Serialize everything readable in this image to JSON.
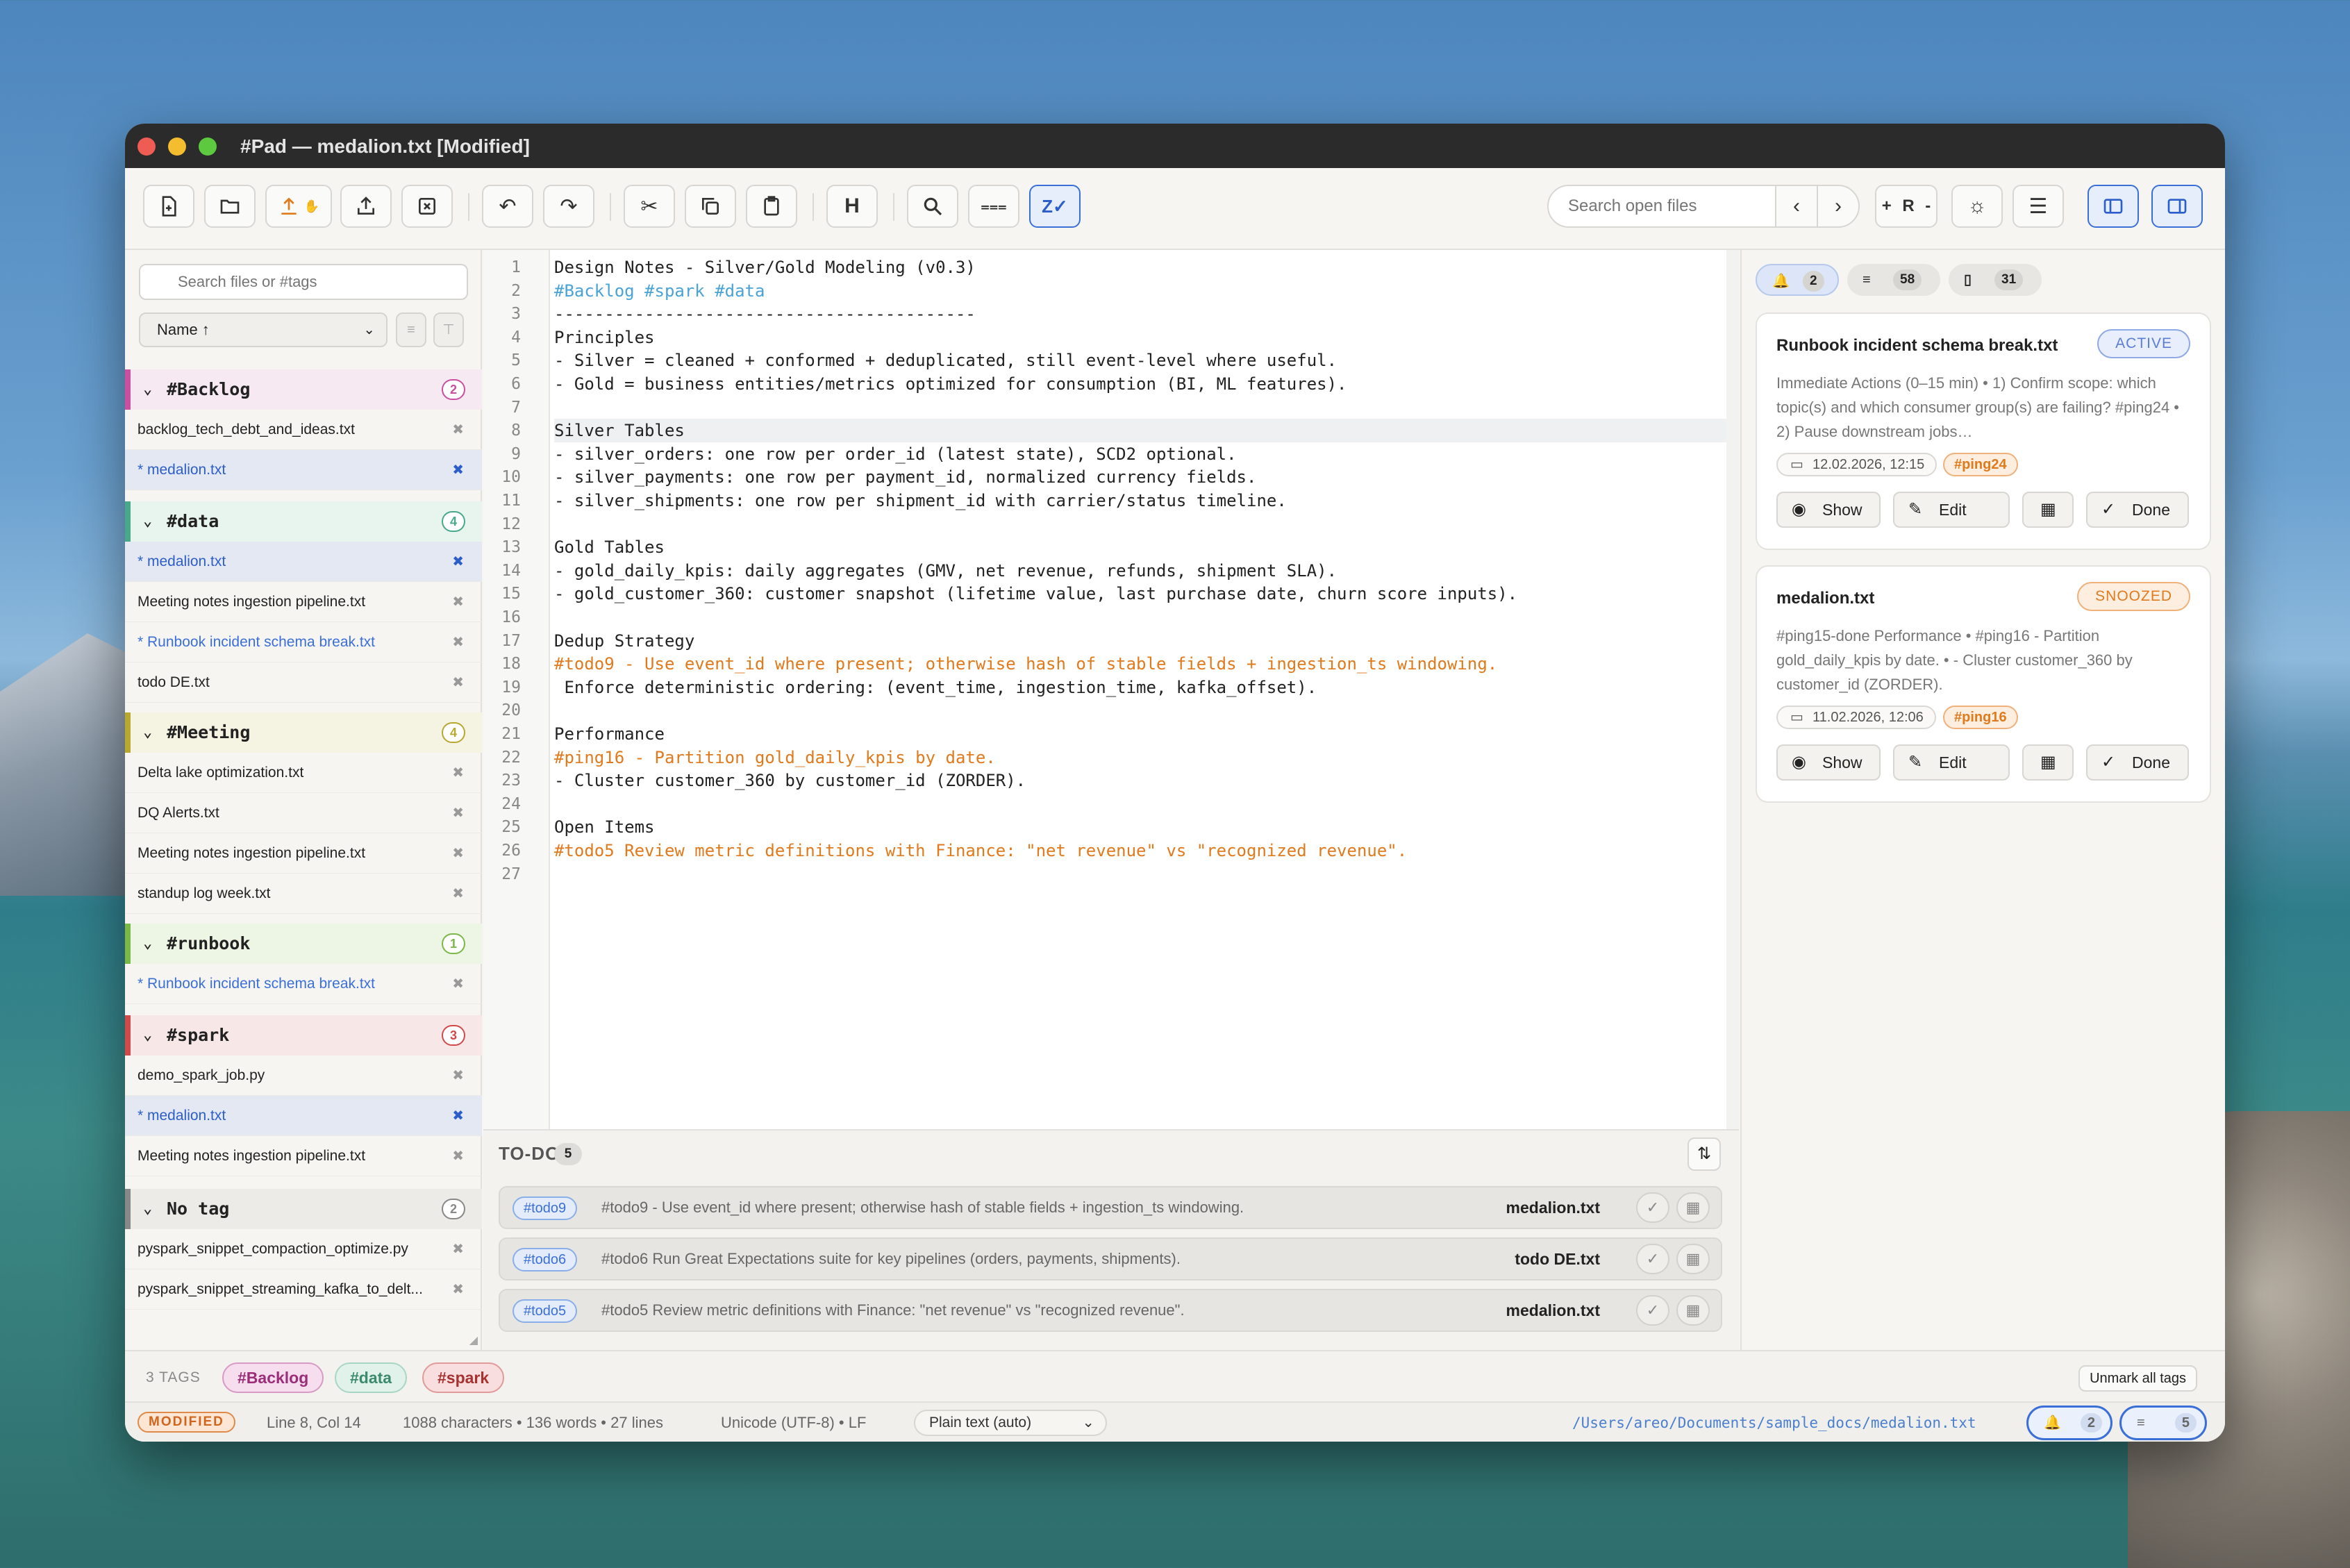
{
  "window": {
    "title": "#Pad — medalion.txt [Modified]"
  },
  "toolbar": {
    "search_placeholder": "Search open files",
    "zoom_plus": "+",
    "zoom_reset": "R",
    "zoom_minus": "-"
  },
  "sidebar": {
    "search_placeholder": "Search files or #tags",
    "sort_label": "Name ↑",
    "groups": [
      {
        "tag": "#Backlog",
        "count": "2",
        "color": "#c94fa0",
        "files": [
          "backlog_tech_debt_and_ideas.txt",
          "* medalion.txt"
        ]
      },
      {
        "tag": "#data",
        "count": "4",
        "color": "#4aa88a",
        "files": [
          "* medalion.txt",
          "Meeting notes ingestion pipeline.txt",
          "* Runbook incident schema break.txt",
          "todo DE.txt"
        ]
      },
      {
        "tag": "#Meeting",
        "count": "4",
        "color": "#b8a830",
        "files": [
          "Delta lake optimization.txt",
          "DQ Alerts.txt",
          "Meeting notes ingestion pipeline.txt",
          "standup log week.txt"
        ]
      },
      {
        "tag": "#runbook",
        "count": "1",
        "color": "#7ab848",
        "files": [
          "* Runbook incident schema break.txt"
        ]
      },
      {
        "tag": "#spark",
        "count": "3",
        "color": "#d04a4a",
        "files": [
          "demo_spark_job.py",
          "* medalion.txt",
          "Meeting notes ingestion pipeline.txt"
        ]
      },
      {
        "tag": "No tag",
        "count": "2",
        "color": "#888888",
        "files": [
          "pyspark_snippet_compaction_optimize.py",
          "pyspark_snippet_streaming_kafka_to_delt..."
        ]
      }
    ]
  },
  "editor": {
    "line_numbers": [
      "1",
      "2",
      "3",
      "4",
      "5",
      "6",
      "7",
      "8",
      "9",
      "10",
      "11",
      "12",
      "13",
      "14",
      "15",
      "16",
      "17",
      "18",
      "19",
      "20",
      "21",
      "22",
      "23",
      "24",
      "25",
      "26",
      "27"
    ],
    "lines": [
      "Design Notes - Silver/Gold Modeling (v0.3)",
      "#Backlog #spark #data",
      "------------------------------------------",
      "Principles",
      "- Silver = cleaned + conformed + deduplicated, still event-level where useful.",
      "- Gold = business entities/metrics optimized for consumption (BI, ML features).",
      "",
      "Silver Tables",
      "- silver_orders: one row per order_id (latest state), SCD2 optional.",
      "- silver_payments: one row per payment_id, normalized currency fields.",
      "- silver_shipments: one row per shipment_id with carrier/status timeline.",
      "",
      "Gold Tables",
      "- gold_daily_kpis: daily aggregates (GMV, net revenue, refunds, shipment SLA).",
      "- gold_customer_360: customer snapshot (lifetime value, last purchase date, churn score inputs).",
      "",
      "Dedup Strategy",
      "#todo9 - Use event_id where present; otherwise hash of stable fields + ingestion_ts windowing.",
      " Enforce deterministic ordering: (event_time, ingestion_time, kafka_offset).",
      "",
      "Performance",
      "#ping16 - Partition gold_daily_kpis by date.",
      "- Cluster customer_360 by customer_id (ZORDER).",
      "",
      "Open Items",
      "#todo5 Review metric definitions with Finance: \"net revenue\" vs \"recognized revenue\".",
      ""
    ]
  },
  "todo": {
    "title": "TO-DO",
    "count": "5",
    "items": [
      {
        "tag": "#todo9",
        "text": "#todo9 - Use event_id where present; otherwise hash of stable fields + ingestion_ts windowing.",
        "file": "medalion.txt"
      },
      {
        "tag": "#todo6",
        "text": "#todo6 Run Great Expectations suite for key pipelines (orders, payments, shipments).",
        "file": "todo DE.txt"
      },
      {
        "tag": "#todo5",
        "text": "#todo5 Review metric definitions with Finance: \"net revenue\" vs \"recognized revenue\".",
        "file": "medalion.txt"
      }
    ]
  },
  "right_panel": {
    "pills": [
      {
        "count": "2"
      },
      {
        "count": "58"
      },
      {
        "count": "31"
      }
    ],
    "cards": [
      {
        "title": "Runbook incident schema break.txt",
        "status": "ACTIVE",
        "body": "Immediate Actions (0–15 min) • 1) Confirm scope: which topic(s) and which consumer group(s) are failing? #ping24 • 2) Pause downstream jobs…",
        "date": "12.02.2026, 12:15",
        "tag": "#ping24"
      },
      {
        "title": "medalion.txt",
        "status": "SNOOZED",
        "body": "#ping15-done Performance • #ping16 - Partition gold_daily_kpis by date. • - Cluster customer_360 by customer_id (ZORDER).",
        "date": "11.02.2026, 12:06",
        "tag": "#ping16"
      }
    ],
    "btn_show": "Show",
    "btn_edit": "Edit",
    "btn_done": "Done"
  },
  "tagbar": {
    "count_label": "3 TAGS",
    "tags": [
      "#Backlog",
      "#data",
      "#spark"
    ],
    "unmark_label": "Unmark all tags"
  },
  "status": {
    "modified": "MODIFIED",
    "position": "Line 8, Col 14",
    "stats": "1088 characters • 136 words • 27 lines",
    "encoding": "Unicode (UTF-8) • LF",
    "language": "Plain text (auto)",
    "path": "/Users/areo/Documents/sample_docs/medalion.txt",
    "bell_count": "2",
    "list_count": "5"
  }
}
